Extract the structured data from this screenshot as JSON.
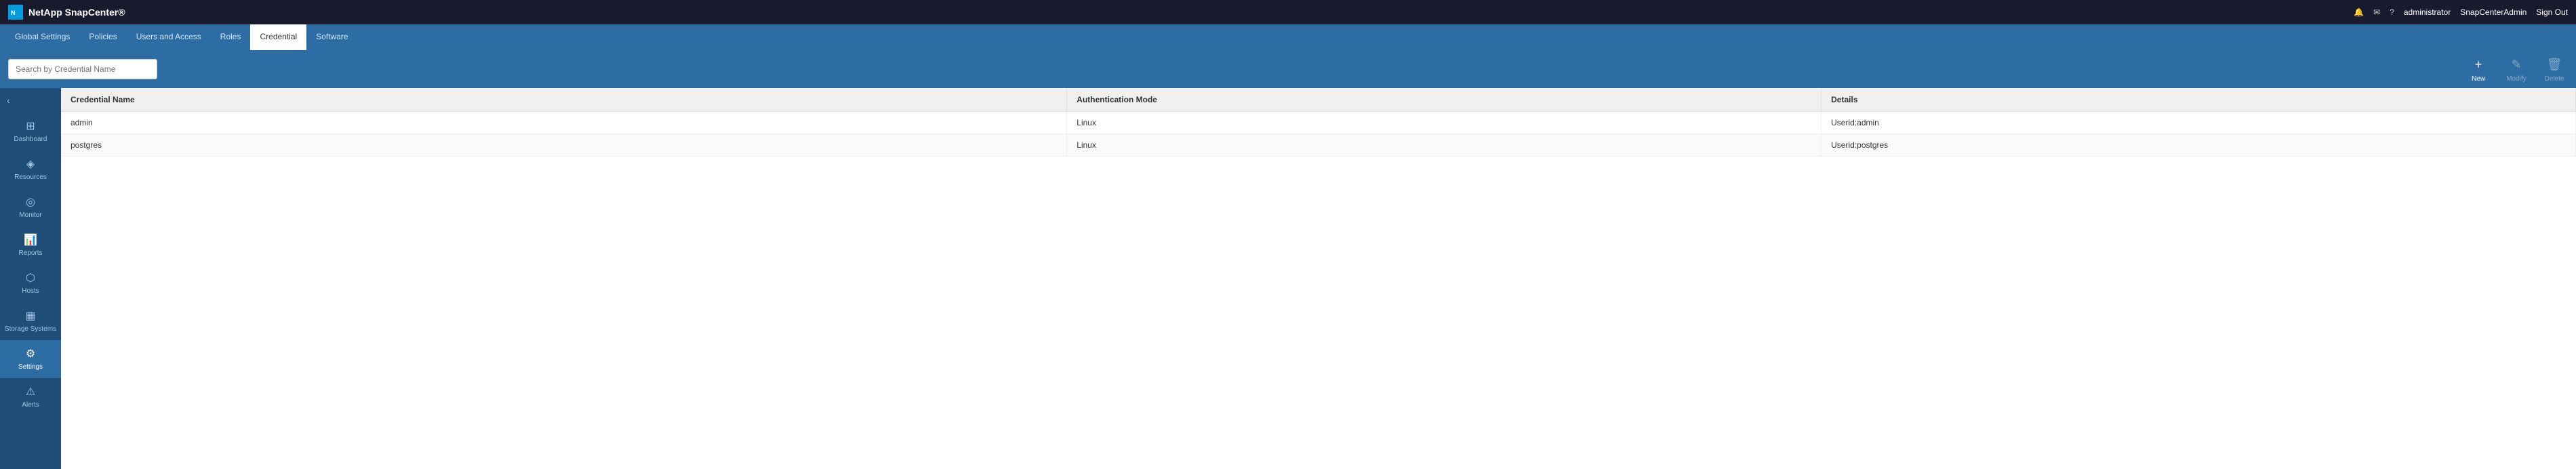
{
  "app": {
    "logo_text": "NetApp SnapCenter®"
  },
  "top_navbar": {
    "notification_icon": "bell",
    "message_icon": "envelope",
    "help_icon": "question",
    "user_label": "administrator",
    "tenant_label": "SnapCenterAdmin",
    "signout_label": "Sign Out"
  },
  "sub_nav": {
    "items": [
      {
        "id": "global-settings",
        "label": "Global Settings",
        "active": false
      },
      {
        "id": "policies",
        "label": "Policies",
        "active": false
      },
      {
        "id": "users-and-access",
        "label": "Users and Access",
        "active": false
      },
      {
        "id": "roles",
        "label": "Roles",
        "active": false
      },
      {
        "id": "credential",
        "label": "Credential",
        "active": true
      },
      {
        "id": "software",
        "label": "Software",
        "active": false
      }
    ]
  },
  "toolbar": {
    "search_placeholder": "Search by Credential Name",
    "new_button": "New",
    "modify_button": "Modify",
    "delete_button": "Delete"
  },
  "sidebar": {
    "toggle_icon": "chevron-left",
    "items": [
      {
        "id": "dashboard",
        "label": "Dashboard",
        "icon": "⊞",
        "active": false
      },
      {
        "id": "resources",
        "label": "Resources",
        "icon": "◈",
        "active": false
      },
      {
        "id": "monitor",
        "label": "Monitor",
        "icon": "◎",
        "active": false
      },
      {
        "id": "reports",
        "label": "Reports",
        "icon": "📊",
        "active": false
      },
      {
        "id": "hosts",
        "label": "Hosts",
        "icon": "⬡",
        "active": false
      },
      {
        "id": "storage-systems",
        "label": "Storage Systems",
        "icon": "▦",
        "active": false
      },
      {
        "id": "settings",
        "label": "Settings",
        "icon": "⚙",
        "active": true
      },
      {
        "id": "alerts",
        "label": "Alerts",
        "icon": "⚠",
        "active": false
      }
    ]
  },
  "table": {
    "columns": [
      {
        "id": "credential-name",
        "label": "Credential Name"
      },
      {
        "id": "authentication-mode",
        "label": "Authentication Mode"
      },
      {
        "id": "details",
        "label": "Details"
      }
    ],
    "rows": [
      {
        "credential_name": "admin",
        "authentication_mode": "Linux",
        "details": "Userid:admin"
      },
      {
        "credential_name": "postgres",
        "authentication_mode": "Linux",
        "details": "Userid:postgres"
      }
    ]
  }
}
